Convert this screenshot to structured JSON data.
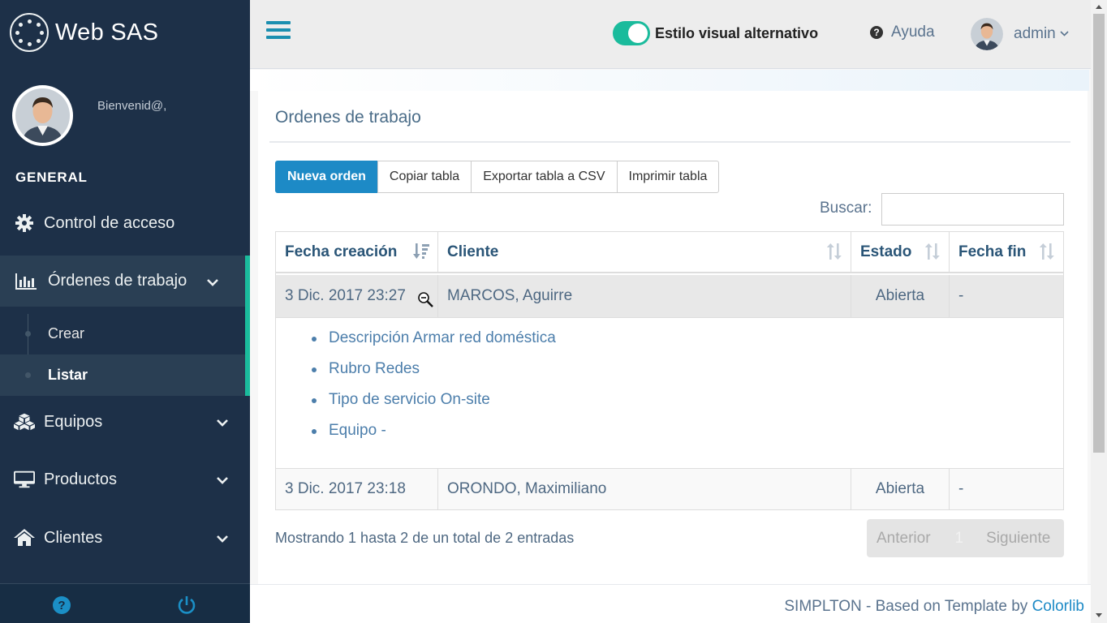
{
  "app": {
    "brand": "Web SAS"
  },
  "sidebar": {
    "welcome": "Bienvenid@,",
    "section": "GENERAL",
    "items": [
      {
        "label": "Control de acceso",
        "icon": "gear-icon"
      },
      {
        "label": "Órdenes de trabajo",
        "icon": "bar-chart-icon",
        "expanded": true
      },
      {
        "label": "Equipos",
        "icon": "cubes-icon"
      },
      {
        "label": "Productos",
        "icon": "desktop-icon"
      },
      {
        "label": "Clientes",
        "icon": "home-icon"
      }
    ],
    "subitems": [
      {
        "label": "Crear"
      },
      {
        "label": "Listar",
        "current": true
      }
    ]
  },
  "topbar": {
    "toggle_label": "Estilo visual alternativo",
    "toggle_on": true,
    "help_label": "Ayuda",
    "user_name": "admin"
  },
  "panel": {
    "title": "Ordenes de trabajo",
    "buttons": {
      "new_order": "Nueva orden",
      "copy": "Copiar tabla",
      "export_csv": "Exportar tabla a CSV",
      "print": "Imprimir tabla"
    },
    "search_label": "Buscar:",
    "search_value": ""
  },
  "table": {
    "headers": [
      "Fecha creación",
      "Cliente",
      "Estado",
      "Fecha fin"
    ],
    "rows": [
      {
        "fecha": "3 Dic. 2017 23:27",
        "cliente": "MARCOS, Aguirre",
        "estado": "Abierta",
        "fin": "-"
      },
      {
        "fecha": "3 Dic. 2017 23:18",
        "cliente": "ORONDO, Maximiliano",
        "estado": "Abierta",
        "fin": "-"
      }
    ],
    "detail": [
      "Descripción Armar red doméstica",
      "Rubro Redes",
      "Tipo de servicio On-site",
      "Equipo -"
    ],
    "info": "Mostrando 1 hasta 2 de un total de 2 entradas",
    "pager": {
      "prev": "Anterior",
      "page": "1",
      "next": "Siguiente"
    }
  },
  "footer": {
    "text": "SIMPLTON - Based on Template by ",
    "link": "Colorlib"
  },
  "colors": {
    "sidebar": "#1D3048",
    "accent": "#1ABB9C",
    "primary": "#1D8AC6"
  }
}
